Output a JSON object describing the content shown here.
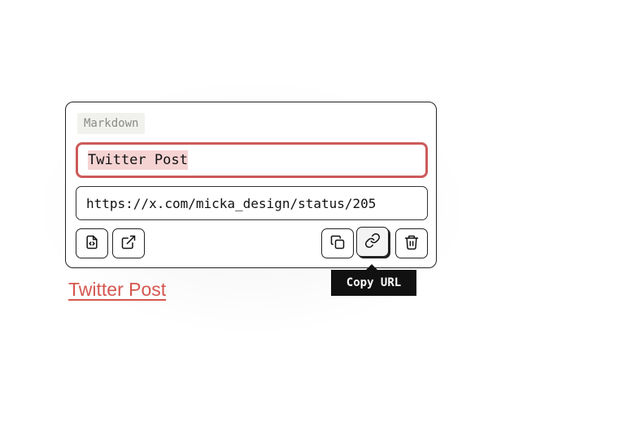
{
  "popover": {
    "format_badge": "Markdown",
    "title_value": "Twitter Post",
    "url_value": "https://x.com/micka_design/status/205"
  },
  "toolbar": {
    "left_buttons": [
      "file-code-icon",
      "external-link-icon"
    ],
    "right_buttons": [
      "copy-icon",
      "link-icon",
      "trash-icon"
    ],
    "active_button": "link-icon"
  },
  "tooltip": {
    "label": "Copy URL"
  },
  "link": {
    "text": "Twitter Post"
  },
  "colors": {
    "accent": "#cc5a5a",
    "selection": "#f6d3d3",
    "link": "#d4574f",
    "tooltip_bg": "#111111"
  }
}
